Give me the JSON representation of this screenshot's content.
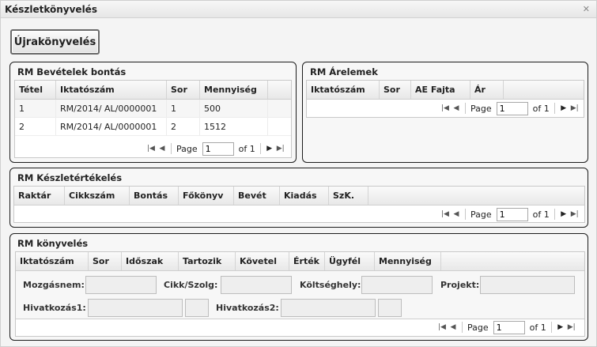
{
  "window": {
    "title": "Készletkönyvelés",
    "close_icon": "close-icon"
  },
  "toolbar": {
    "rebook_label": "Újrakönyvelés"
  },
  "pager": {
    "page_label": "Page",
    "of_label": "of 1",
    "page_value": "1"
  },
  "bevetelek": {
    "title": "RM Bevételek bontás",
    "columns": [
      "Tétel",
      "Iktatószám",
      "Sor",
      "Mennyiség"
    ],
    "rows": [
      [
        "1",
        "RM/2014/  AL/0000001",
        "1",
        "500"
      ],
      [
        "2",
        "RM/2014/  AL/0000001",
        "2",
        "1512"
      ]
    ]
  },
  "arelemek": {
    "title": "RM Árelemek",
    "columns": [
      "Iktatószám",
      "Sor",
      "AE Fajta",
      "Ár"
    ]
  },
  "keszletertekeles": {
    "title": "RM Készletértékelés",
    "columns": [
      "Raktár",
      "Cikkszám",
      "Bontás",
      "Főkönyv",
      "Bevét",
      "Kiadás",
      "SzK."
    ]
  },
  "konyveles": {
    "title": "RM könyvelés",
    "columns": [
      "Iktatószám",
      "Sor",
      "Időszak",
      "Tartozik",
      "Követel",
      "Érték",
      "Ügyfél",
      "Mennyiség"
    ],
    "fields": {
      "mozgasnem": "Mozgásnem:",
      "cikk": "Cikk/Szolg:",
      "koltseghely": "Költséghely:",
      "projekt": "Projekt:",
      "hivatkozas1": "Hivatkozás1:",
      "hivatkozas2": "Hivatkozás2:"
    }
  }
}
